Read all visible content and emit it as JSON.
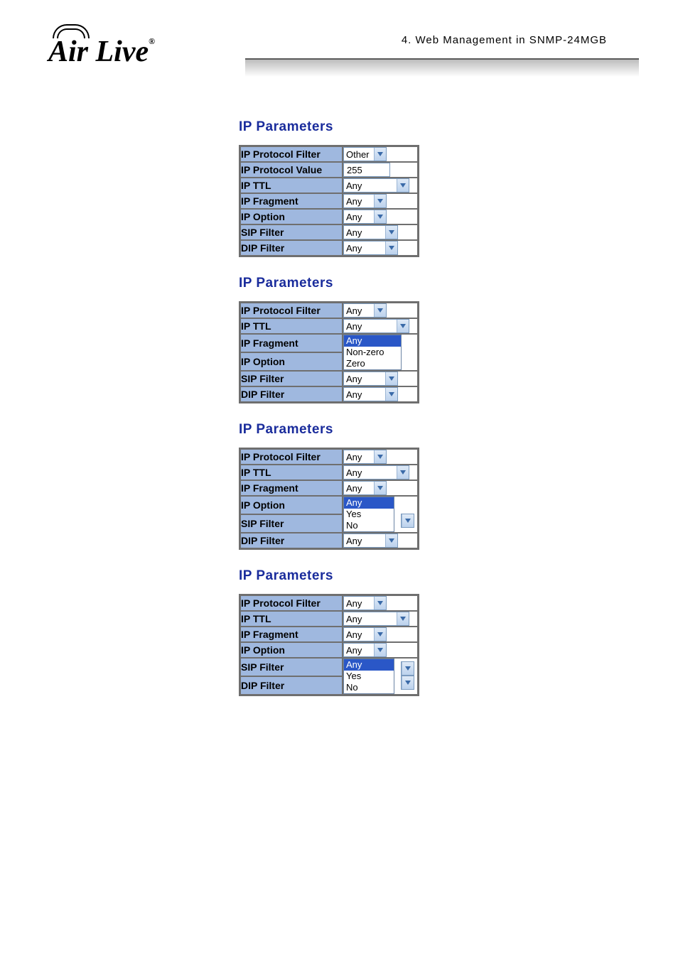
{
  "header": {
    "breadcrumb": "4.  Web Management in SNMP-24MGB",
    "logo_text": "Air Live"
  },
  "sections": [
    {
      "title": "IP Parameters",
      "rows": [
        {
          "label": "IP Protocol Filter",
          "type": "dd",
          "value": "Other",
          "w": "w40"
        },
        {
          "label": "IP Protocol Value",
          "type": "input",
          "value": "255"
        },
        {
          "label": "IP TTL",
          "type": "dd",
          "value": "Any",
          "w": "w72"
        },
        {
          "label": "IP Fragment",
          "type": "dd",
          "value": "Any",
          "w": "w40"
        },
        {
          "label": "IP Option",
          "type": "dd",
          "value": "Any",
          "w": "w40"
        },
        {
          "label": "SIP Filter",
          "type": "dd",
          "value": "Any",
          "w": "w55"
        },
        {
          "label": "DIP Filter",
          "type": "dd",
          "value": "Any",
          "w": "w55"
        }
      ]
    },
    {
      "title": "IP Parameters",
      "rows": [
        {
          "label": "IP Protocol Filter",
          "type": "dd",
          "value": "Any",
          "w": "w40"
        },
        {
          "label": "IP TTL",
          "type": "dd",
          "value": "Any",
          "w": "w72"
        },
        {
          "label": "IP Fragment",
          "type": "open",
          "selected": "Any",
          "options": [
            "Non-zero",
            "Zero"
          ],
          "ow": "w80"
        },
        {
          "label": "IP Option",
          "type": "spacer"
        },
        {
          "label": "SIP Filter",
          "type": "dd",
          "value": "Any",
          "w": "w55"
        },
        {
          "label": "DIP Filter",
          "type": "dd",
          "value": "Any",
          "w": "w55"
        }
      ]
    },
    {
      "title": "IP Parameters",
      "rows": [
        {
          "label": "IP Protocol Filter",
          "type": "dd",
          "value": "Any",
          "w": "w40"
        },
        {
          "label": "IP TTL",
          "type": "dd",
          "value": "Any",
          "w": "w72"
        },
        {
          "label": "IP Fragment",
          "type": "dd",
          "value": "Any",
          "w": "w40"
        },
        {
          "label": "IP Option",
          "type": "open",
          "selected": "Any",
          "options": [
            "Yes",
            "No"
          ],
          "trail_dd": "w55"
        },
        {
          "label": "SIP Filter",
          "type": "spacer"
        },
        {
          "label": "DIP Filter",
          "type": "dd",
          "value": "Any",
          "w": "w55"
        }
      ]
    },
    {
      "title": "IP Parameters",
      "rows": [
        {
          "label": "IP Protocol Filter",
          "type": "dd",
          "value": "Any",
          "w": "w40"
        },
        {
          "label": "IP TTL",
          "type": "dd",
          "value": "Any",
          "w": "w72"
        },
        {
          "label": "IP Fragment",
          "type": "dd",
          "value": "Any",
          "w": "w40"
        },
        {
          "label": "IP Option",
          "type": "dd",
          "value": "Any",
          "w": "w40"
        },
        {
          "label": "SIP Filter",
          "type": "open",
          "selected": "Any",
          "options": [
            "Yes",
            "No"
          ],
          "trail_dd": "w55"
        },
        {
          "label": "DIP Filter",
          "type": "spacer_dd",
          "w": "w55"
        }
      ]
    }
  ]
}
